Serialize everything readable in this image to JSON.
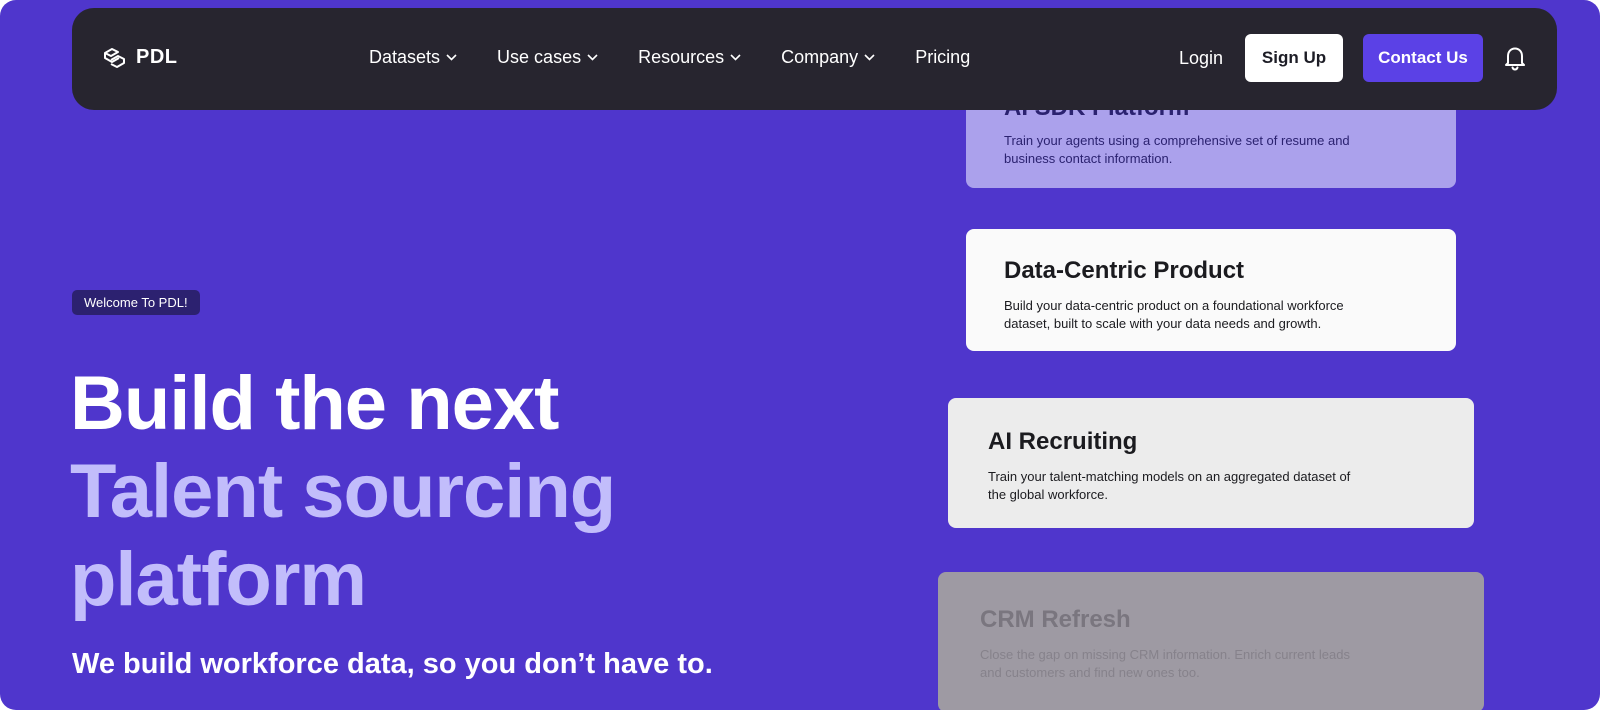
{
  "nav": {
    "brand": "PDL",
    "menu": [
      {
        "label": "Datasets",
        "has_dropdown": true
      },
      {
        "label": "Use cases",
        "has_dropdown": true
      },
      {
        "label": "Resources",
        "has_dropdown": true
      },
      {
        "label": "Company",
        "has_dropdown": true
      },
      {
        "label": "Pricing",
        "has_dropdown": false
      }
    ],
    "login_label": "Login",
    "signup_label": "Sign Up",
    "contact_label": "Contact Us"
  },
  "hero": {
    "badge": "Welcome To PDL!",
    "headline": "Build the next",
    "headline_accent": "Talent sourcing platform",
    "subheadline": "We build workforce data, so you don’t have to."
  },
  "cards": [
    {
      "title": "AI SDK Platform",
      "description": "Train your agents using a comprehensive set of resume and business contact information."
    },
    {
      "title": "Data-Centric Product",
      "description": "Build your data-centric product on a foundational workforce dataset, built to scale with your data needs and growth."
    },
    {
      "title": "AI Recruiting",
      "description": "Train your talent-matching models on an aggregated dataset of the global workforce."
    },
    {
      "title": "CRM Refresh",
      "description": "Close the gap on missing CRM information. Enrich current leads and customers and find new ones too."
    }
  ],
  "icons": {
    "brand": "pdl-logo-icon",
    "dropdown": "chevron-down-icon",
    "notifications": "bell-icon"
  },
  "colors": {
    "background": "#4f36cc",
    "nav_background": "#27252f",
    "accent_text": "#c2bdfb",
    "contact_button": "#5b41e6"
  }
}
